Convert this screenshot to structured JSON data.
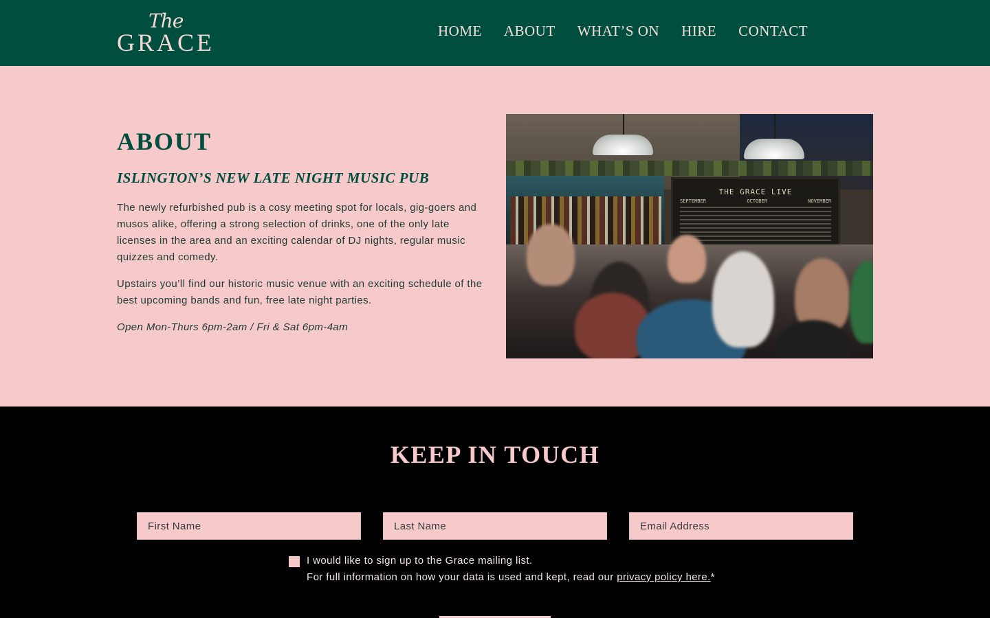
{
  "header": {
    "logo_the": "The",
    "logo_grace": "GRACE",
    "nav": [
      "HOME",
      "ABOUT",
      "WHAT’S ON",
      "HIRE",
      "CONTACT"
    ]
  },
  "about": {
    "title": "ABOUT",
    "subtitle": "ISLINGTON’S NEW LATE NIGHT MUSIC PUB",
    "paragraph1": "The newly refurbished pub is a cosy meeting spot for locals, gig-goers and musos alike, offering a strong selection of drinks, one of the only late licenses in the area and an exciting calendar of DJ nights, regular music quizzes and comedy.",
    "paragraph2": "Upstairs you’ll find our historic music venue with an exciting schedule of the best upcoming bands and fun, free late night parties.",
    "hours": "Open Mon-Thurs 6pm-2am / Fri & Sat 6pm-4am",
    "photo": {
      "board_title": "THE GRACE LIVE",
      "board_months": [
        "SEPTEMBER",
        "OCTOBER",
        "NOVEMBER"
      ]
    }
  },
  "touch": {
    "title": "KEEP IN TOUCH",
    "first_name_placeholder": "First Name",
    "last_name_placeholder": "Last Name",
    "email_placeholder": "Email Address",
    "consent_line1": "I would like to sign up to the Grace mailing list.",
    "consent_line2": "For full information on how your data is used and kept, read our ",
    "privacy_link": "privacy policy here.",
    "required_mark": "*"
  },
  "colors": {
    "brand_green": "#004f3e",
    "brand_pink": "#f6c9cb",
    "footer_black": "#000000"
  },
  "icons": [
    "checkbox-icon"
  ]
}
